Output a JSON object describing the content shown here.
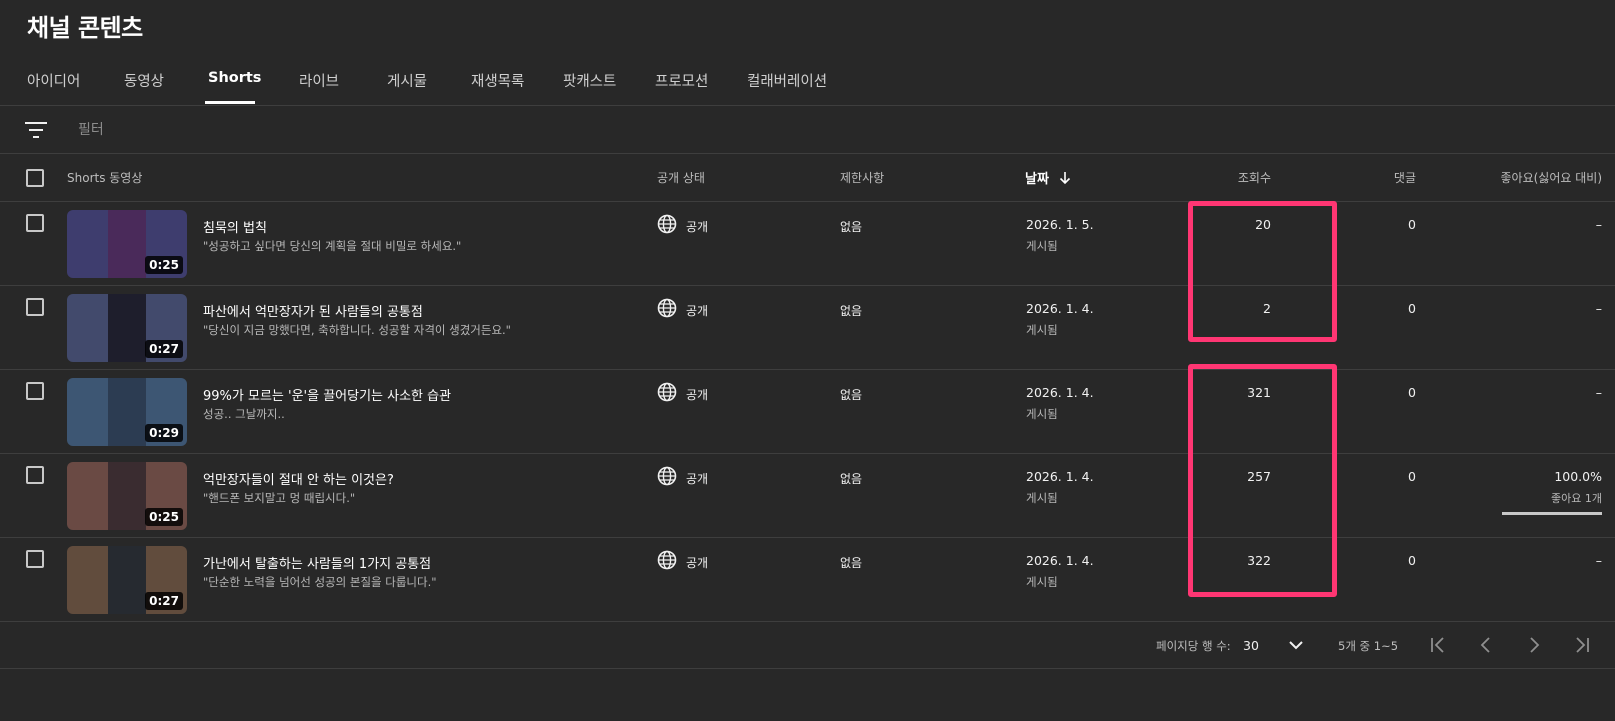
{
  "page": {
    "title": "채널 콘텐츠"
  },
  "tabs": [
    "아이디어",
    "동영상",
    "Shorts",
    "라이브",
    "게시물",
    "재생목록",
    "팟캐스트",
    "프로모션",
    "컬래버레이션"
  ],
  "active_tab": "Shorts",
  "filter": {
    "placeholder": "필터",
    "icon": "filter-lines-icon"
  },
  "table": {
    "headers": {
      "video": "Shorts 동영상",
      "visibility": "공개 상태",
      "restrictions": "제한사항",
      "date": "날짜",
      "views": "조회수",
      "comments": "댓글",
      "likes": "좋아요(싫어요 대비)"
    },
    "sort": {
      "column": "date",
      "direction": "descending",
      "icon": "arrow-down-icon"
    },
    "rows": [
      {
        "title": "침묵의 법칙",
        "description": "\"성공하고 싶다면 당신의 계획을 절대 비밀로 하세요.\"",
        "duration": "0:25",
        "visibility": "공개",
        "restrictions": "없음",
        "date": "2026. 1. 5.",
        "status": "게시됨",
        "views": "20",
        "comments": "0",
        "likes": "–",
        "likes_sub": "",
        "likes_ratio": null,
        "thumb_bg": "#3e3d6e",
        "thumb_fg": "#4a2a5a"
      },
      {
        "title": "파산에서 억만장자가 된 사람들의 공통점",
        "description": "\"당신이 지금 망했다면, 축하합니다. 성공할 자격이 생겼거든요.\"",
        "duration": "0:27",
        "visibility": "공개",
        "restrictions": "없음",
        "date": "2026. 1. 4.",
        "status": "게시됨",
        "views": "2",
        "comments": "0",
        "likes": "–",
        "likes_sub": "",
        "likes_ratio": null,
        "thumb_bg": "#424a6c",
        "thumb_fg": "#1e1e2c"
      },
      {
        "title": "99%가 모르는 '운'을 끌어당기는 사소한 습관",
        "description": "성공.. 그날까지..",
        "duration": "0:29",
        "visibility": "공개",
        "restrictions": "없음",
        "date": "2026. 1. 4.",
        "status": "게시됨",
        "views": "321",
        "comments": "0",
        "likes": "–",
        "likes_sub": "",
        "likes_ratio": null,
        "thumb_bg": "#3d5673",
        "thumb_fg": "#2c3c52"
      },
      {
        "title": "억만장자들이 절대 안 하는 이것은?",
        "description": "\"핸드폰 보지말고 멍 때립시다.\"",
        "duration": "0:25",
        "visibility": "공개",
        "restrictions": "없음",
        "date": "2026. 1. 4.",
        "status": "게시됨",
        "views": "257",
        "comments": "0",
        "likes": "100.0%",
        "likes_sub": "좋아요 1개",
        "likes_ratio": 1.0,
        "thumb_bg": "#6a4a44",
        "thumb_fg": "#3a2c30"
      },
      {
        "title": "가난에서 탈출하는 사람들의 1가지 공통점",
        "description": "\"단순한 노력을 넘어선 성공의 본질을 다룹니다.\"",
        "duration": "0:27",
        "visibility": "공개",
        "restrictions": "없음",
        "date": "2026. 1. 4.",
        "status": "게시됨",
        "views": "322",
        "comments": "0",
        "likes": "–",
        "likes_sub": "",
        "likes_ratio": null,
        "thumb_bg": "#614c3d",
        "thumb_fg": "#262a30"
      }
    ]
  },
  "pagination": {
    "rows_per_page_label": "페이지당 행 수:",
    "rows_per_page": "30",
    "range": "5개 중 1~5"
  },
  "colors": {
    "background": "#282828",
    "highlight": "#ff3673",
    "divider": "#3e3e3e"
  }
}
